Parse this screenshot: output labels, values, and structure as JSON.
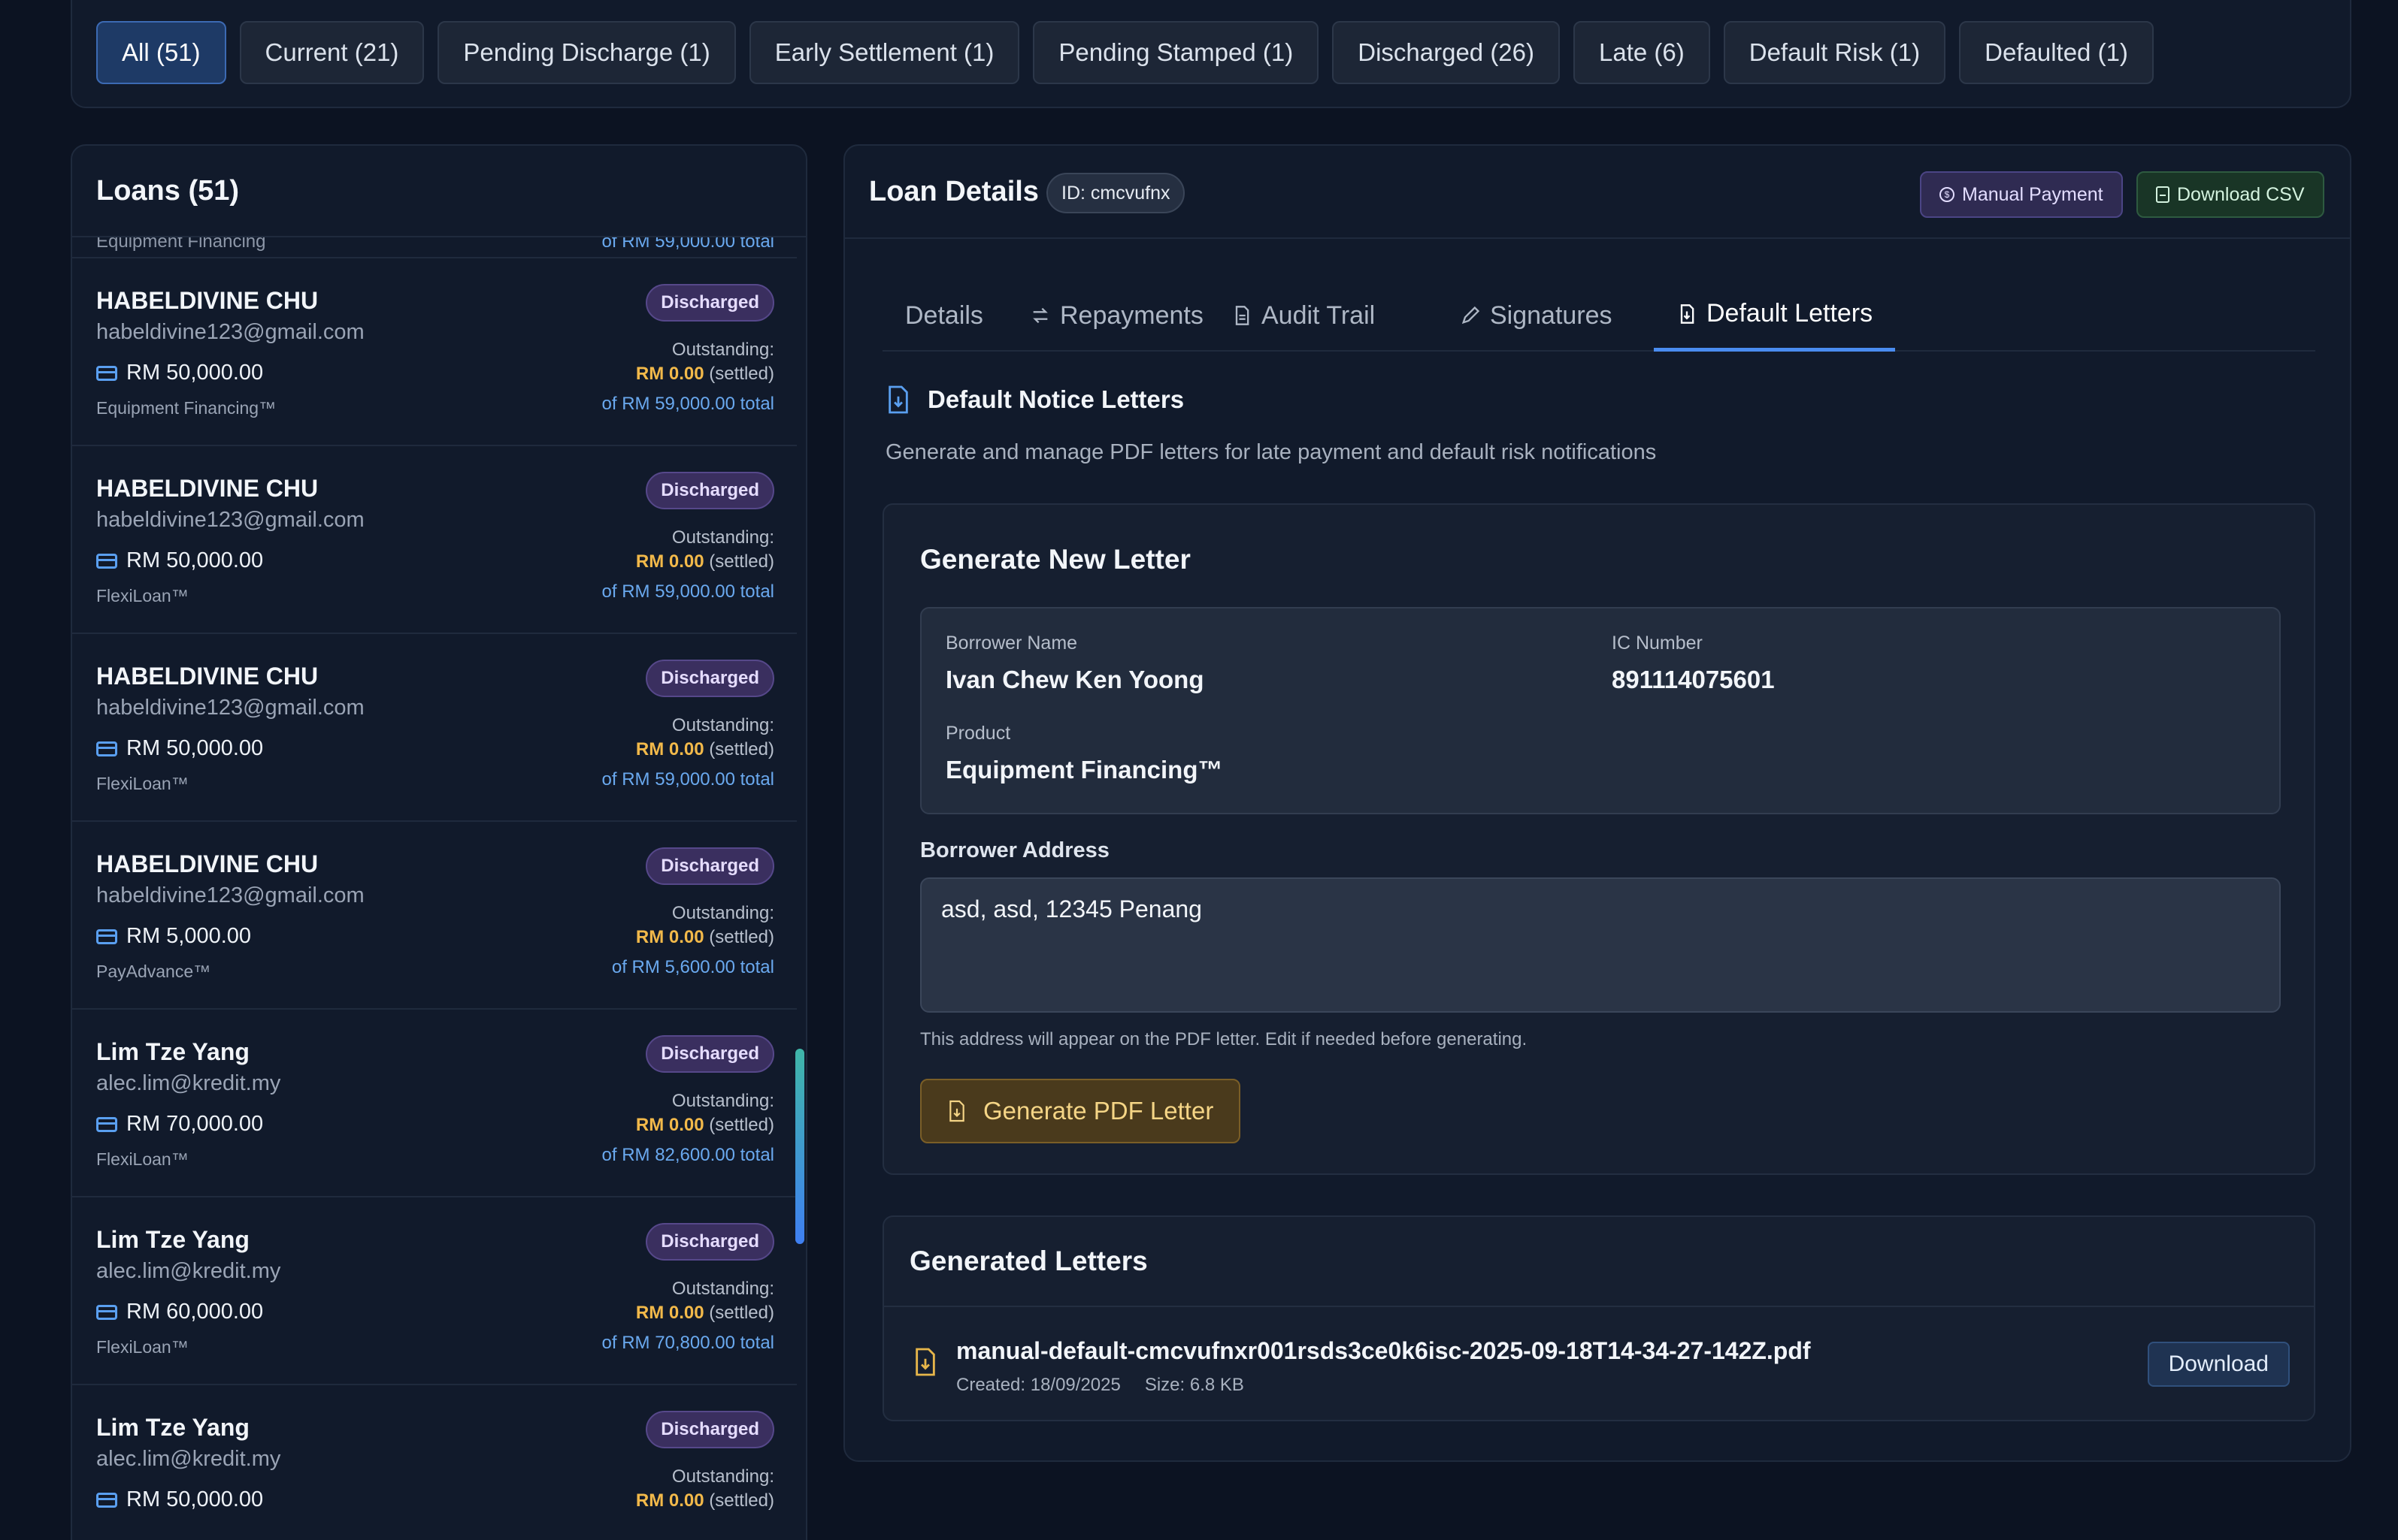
{
  "filters": [
    {
      "label": "All (51)",
      "active": true
    },
    {
      "label": "Current (21)"
    },
    {
      "label": "Pending Discharge (1)"
    },
    {
      "label": "Early Settlement (1)"
    },
    {
      "label": "Pending Stamped (1)"
    },
    {
      "label": "Discharged (26)"
    },
    {
      "label": "Late (6)"
    },
    {
      "label": "Default Risk (1)"
    },
    {
      "label": "Defaulted (1)"
    }
  ],
  "loans": {
    "title": "Loans (51)",
    "partial_top": {
      "product": "Equipment Financing",
      "total": "of RM 59,000.00 total"
    },
    "outstanding_label": "Outstanding:",
    "settled_suffix": "(settled)",
    "items": [
      {
        "name": "HABELDIVINE CHU",
        "email": "habeldivine123@gmail.com",
        "amount": "RM 50,000.00",
        "product": "Equipment Financing™",
        "status": "Discharged",
        "outstanding": "RM 0.00",
        "total": "of RM 59,000.00 total"
      },
      {
        "name": "HABELDIVINE CHU",
        "email": "habeldivine123@gmail.com",
        "amount": "RM 50,000.00",
        "product": "FlexiLoan™",
        "status": "Discharged",
        "outstanding": "RM 0.00",
        "total": "of RM 59,000.00 total"
      },
      {
        "name": "HABELDIVINE CHU",
        "email": "habeldivine123@gmail.com",
        "amount": "RM 50,000.00",
        "product": "FlexiLoan™",
        "status": "Discharged",
        "outstanding": "RM 0.00",
        "total": "of RM 59,000.00 total"
      },
      {
        "name": "HABELDIVINE CHU",
        "email": "habeldivine123@gmail.com",
        "amount": "RM 5,000.00",
        "product": "PayAdvance™",
        "status": "Discharged",
        "outstanding": "RM 0.00",
        "total": "of RM 5,600.00 total"
      },
      {
        "name": "Lim Tze Yang",
        "email": "alec.lim@kredit.my",
        "amount": "RM 70,000.00",
        "product": "FlexiLoan™",
        "status": "Discharged",
        "outstanding": "RM 0.00",
        "total": "of RM 82,600.00 total"
      },
      {
        "name": "Lim Tze Yang",
        "email": "alec.lim@kredit.my",
        "amount": "RM 60,000.00",
        "product": "FlexiLoan™",
        "status": "Discharged",
        "outstanding": "RM 0.00",
        "total": "of RM 70,800.00 total"
      },
      {
        "name": "Lim Tze Yang",
        "email": "alec.lim@kredit.my",
        "amount": "RM 50,000.00",
        "product": "",
        "status": "Discharged",
        "outstanding": "RM 0.00",
        "total": ""
      }
    ]
  },
  "details": {
    "title": "Loan Details",
    "id_chip": "ID: cmcvufnx",
    "manual_payment": "Manual Payment",
    "download_csv": "Download CSV",
    "tabs": [
      {
        "label": "Details",
        "icon": "none"
      },
      {
        "label": "Repayments",
        "icon": "arrows-icon"
      },
      {
        "label": "Audit Trail",
        "icon": "document-icon"
      },
      {
        "label": "Signatures",
        "icon": "pen-icon"
      },
      {
        "label": "Default Letters",
        "icon": "file-download-icon",
        "active": true
      }
    ],
    "section_title": "Default Notice Letters",
    "section_desc": "Generate and manage PDF letters for late payment and default risk notifications",
    "generate": {
      "title": "Generate New Letter",
      "borrower_name_label": "Borrower Name",
      "borrower_name": "Ivan Chew Ken Yoong",
      "ic_label": "IC Number",
      "ic_number": "891114075601",
      "product_label": "Product",
      "product": "Equipment Financing™",
      "address_label": "Borrower Address",
      "address": "asd, asd, 12345 Penang",
      "address_hint": "This address will appear on the PDF letter. Edit if needed before generating.",
      "button": "Generate PDF Letter"
    },
    "generated": {
      "title": "Generated Letters",
      "file_name": "manual-default-cmcvufnxr001rsds3ce0k6isc-2025-09-18T14-34-27-142Z.pdf",
      "created": "Created: 18/09/2025",
      "size": "Size: 6.8 KB",
      "download": "Download"
    }
  }
}
